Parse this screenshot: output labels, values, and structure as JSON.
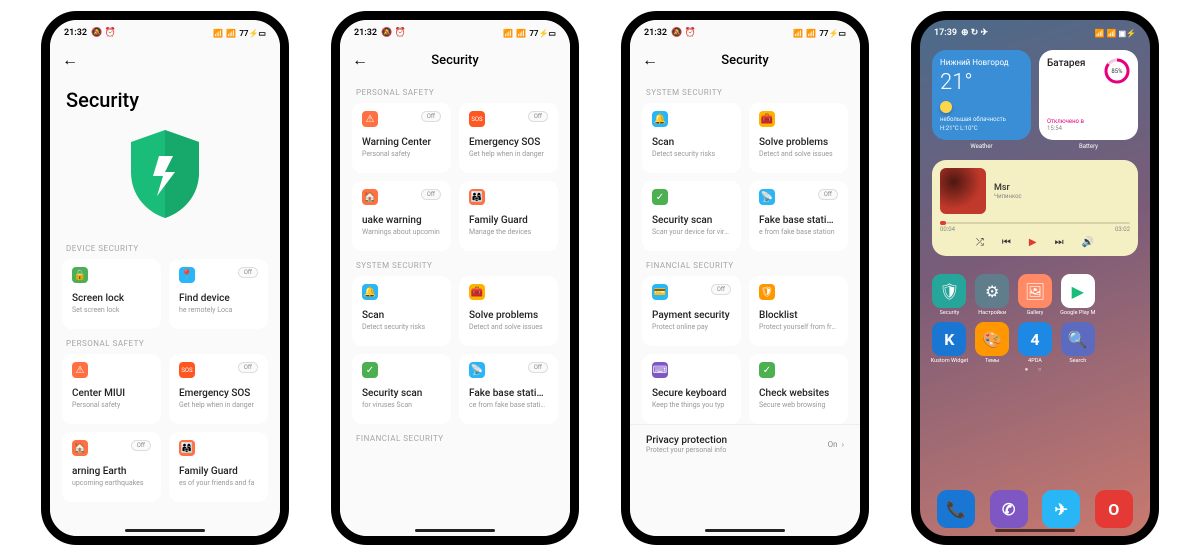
{
  "p1": {
    "time": "21:32",
    "battery": "77",
    "title": "Security",
    "section1": "DEVICE SECURITY",
    "tiles1": [
      {
        "icon": "🔒",
        "color": "#4caf50",
        "title": "Screen lock",
        "sub": "Set screen lock",
        "toggle": ""
      },
      {
        "icon": "📍",
        "color": "#29b6f6",
        "title": "Find device",
        "sub": "he remotely        Loca",
        "toggle": "Off"
      }
    ],
    "section2": "PERSONAL SAFETY",
    "tiles2": [
      {
        "icon": "⚠",
        "color": "#ff7043",
        "title": "Center        MIUI",
        "sub": "Personal safety",
        "toggle": ""
      },
      {
        "icon": "SOS",
        "color": "#ff5722",
        "title": "Emergency SOS",
        "sub": "Get help when in danger",
        "toggle": "Off"
      },
      {
        "icon": "🏠",
        "color": "#ff7043",
        "title": "arning        Earth",
        "sub": "upcoming earthquakes",
        "toggle": "Off"
      },
      {
        "icon": "👨‍👩‍👧",
        "color": "#ff7043",
        "title": "Family Guard",
        "sub": "es of your friends and fa",
        "toggle": ""
      }
    ]
  },
  "p2": {
    "time": "21:32",
    "battery": "77",
    "title": "Security",
    "section1": "PERSONAL SAFETY",
    "tiles1": [
      {
        "icon": "⚠",
        "color": "#ff7043",
        "title": "Warning Center",
        "sub": "Personal safety",
        "toggle": "Off"
      },
      {
        "icon": "SOS",
        "color": "#ff5722",
        "title": "Emergency SOS",
        "sub": "Get help when in danger",
        "toggle": "Off"
      },
      {
        "icon": "🏠",
        "color": "#ff7043",
        "title": "uake warning",
        "sub": "Warnings about upcomin",
        "toggle": "Off"
      },
      {
        "icon": "👨‍👩‍👧",
        "color": "#ff7043",
        "title": "Family Guard",
        "sub": "Manage the devices",
        "toggle": ""
      }
    ],
    "section2": "SYSTEM SECURITY",
    "tiles2": [
      {
        "icon": "🔔",
        "color": "#29b6f6",
        "title": "Scan",
        "sub": "Detect security risks",
        "toggle": ""
      },
      {
        "icon": "🧰",
        "color": "#ffb300",
        "title": "Solve problems",
        "sub": "Detect and solve issues",
        "toggle": ""
      },
      {
        "icon": "✓",
        "color": "#4caf50",
        "title": "Security scan",
        "sub": "for viruses        Scan",
        "toggle": ""
      },
      {
        "icon": "📡",
        "color": "#29b6f6",
        "title": "Fake base stations",
        "sub": "ce from fake base station",
        "toggle": "Off"
      }
    ],
    "section3": "FINANCIAL SECURITY"
  },
  "p3": {
    "time": "21:32",
    "battery": "77",
    "title": "Security",
    "section1": "SYSTEM SECURITY",
    "tiles1": [
      {
        "icon": "🔔",
        "color": "#29b6f6",
        "title": "Scan",
        "sub": "Detect security risks",
        "toggle": ""
      },
      {
        "icon": "🧰",
        "color": "#ffb300",
        "title": "Solve problems",
        "sub": "Detect and solve issues",
        "toggle": ""
      },
      {
        "icon": "✓",
        "color": "#4caf50",
        "title": "Security scan",
        "sub": "Scan your device for virus",
        "toggle": ""
      },
      {
        "icon": "📡",
        "color": "#29b6f6",
        "title": "Fake base stations",
        "sub": "e from fake base station",
        "toggle": "Off"
      }
    ],
    "section2": "FINANCIAL SECURITY",
    "tiles2": [
      {
        "icon": "💳",
        "color": "#29b6f6",
        "title": "Payment security",
        "sub": "Protect online pay",
        "toggle": "Off"
      },
      {
        "icon": "🛡",
        "color": "#ff9800",
        "title": "Blocklist",
        "sub": "Protect yourself from frau",
        "toggle": ""
      },
      {
        "icon": "⌨",
        "color": "#7e57c2",
        "title": "Secure keyboard",
        "sub": "Keep the things you typ",
        "toggle": ""
      },
      {
        "icon": "✓",
        "color": "#4caf50",
        "title": "Check websites",
        "sub": "Secure web browsing",
        "toggle": ""
      }
    ],
    "footer_title": "Privacy protection",
    "footer_sub": "Protect your personal info",
    "footer_state": "On"
  },
  "home": {
    "time": "17:39",
    "battery": "",
    "weather": {
      "city": "Нижний Новгород",
      "temp": "21°",
      "desc": "небольшая облачность",
      "hilo": "H:21°C L:10°C",
      "label": "Weather"
    },
    "bat": {
      "title": "Батарея",
      "pct": "85%",
      "state": "Отключено в",
      "t": "15:54",
      "label": "Battery"
    },
    "music": {
      "title": "Msr",
      "artist": "Чипинкос",
      "t0": "00:04",
      "t1": "03:02"
    },
    "apps": [
      {
        "label": "Security",
        "color": "#26a69a",
        "glyph": "🛡"
      },
      {
        "label": "Настройки",
        "color": "#607d8b",
        "glyph": "⚙"
      },
      {
        "label": "Gallery",
        "color": "#ff8a65",
        "glyph": "🖼"
      },
      {
        "label": "Google Play М",
        "color": "#ffffff",
        "glyph": "▶"
      },
      {
        "label": "",
        "color": "transparent",
        "glyph": ""
      },
      {
        "label": "Kustom Widget",
        "color": "#1976d2",
        "glyph": "K"
      },
      {
        "label": "Темы",
        "color": "#ff9800",
        "glyph": "🎨"
      },
      {
        "label": "4PDA",
        "color": "#1e88e5",
        "glyph": "4"
      },
      {
        "label": "Search",
        "color": "#5c6bc0",
        "glyph": "🔍"
      },
      {
        "label": "",
        "color": "transparent",
        "glyph": ""
      }
    ],
    "dock": [
      {
        "color": "#1976d2",
        "glyph": "📞"
      },
      {
        "color": "#7e57c2",
        "glyph": "✆"
      },
      {
        "color": "#29b6f6",
        "glyph": "✈"
      },
      {
        "color": "#e53935",
        "glyph": "O"
      }
    ]
  }
}
